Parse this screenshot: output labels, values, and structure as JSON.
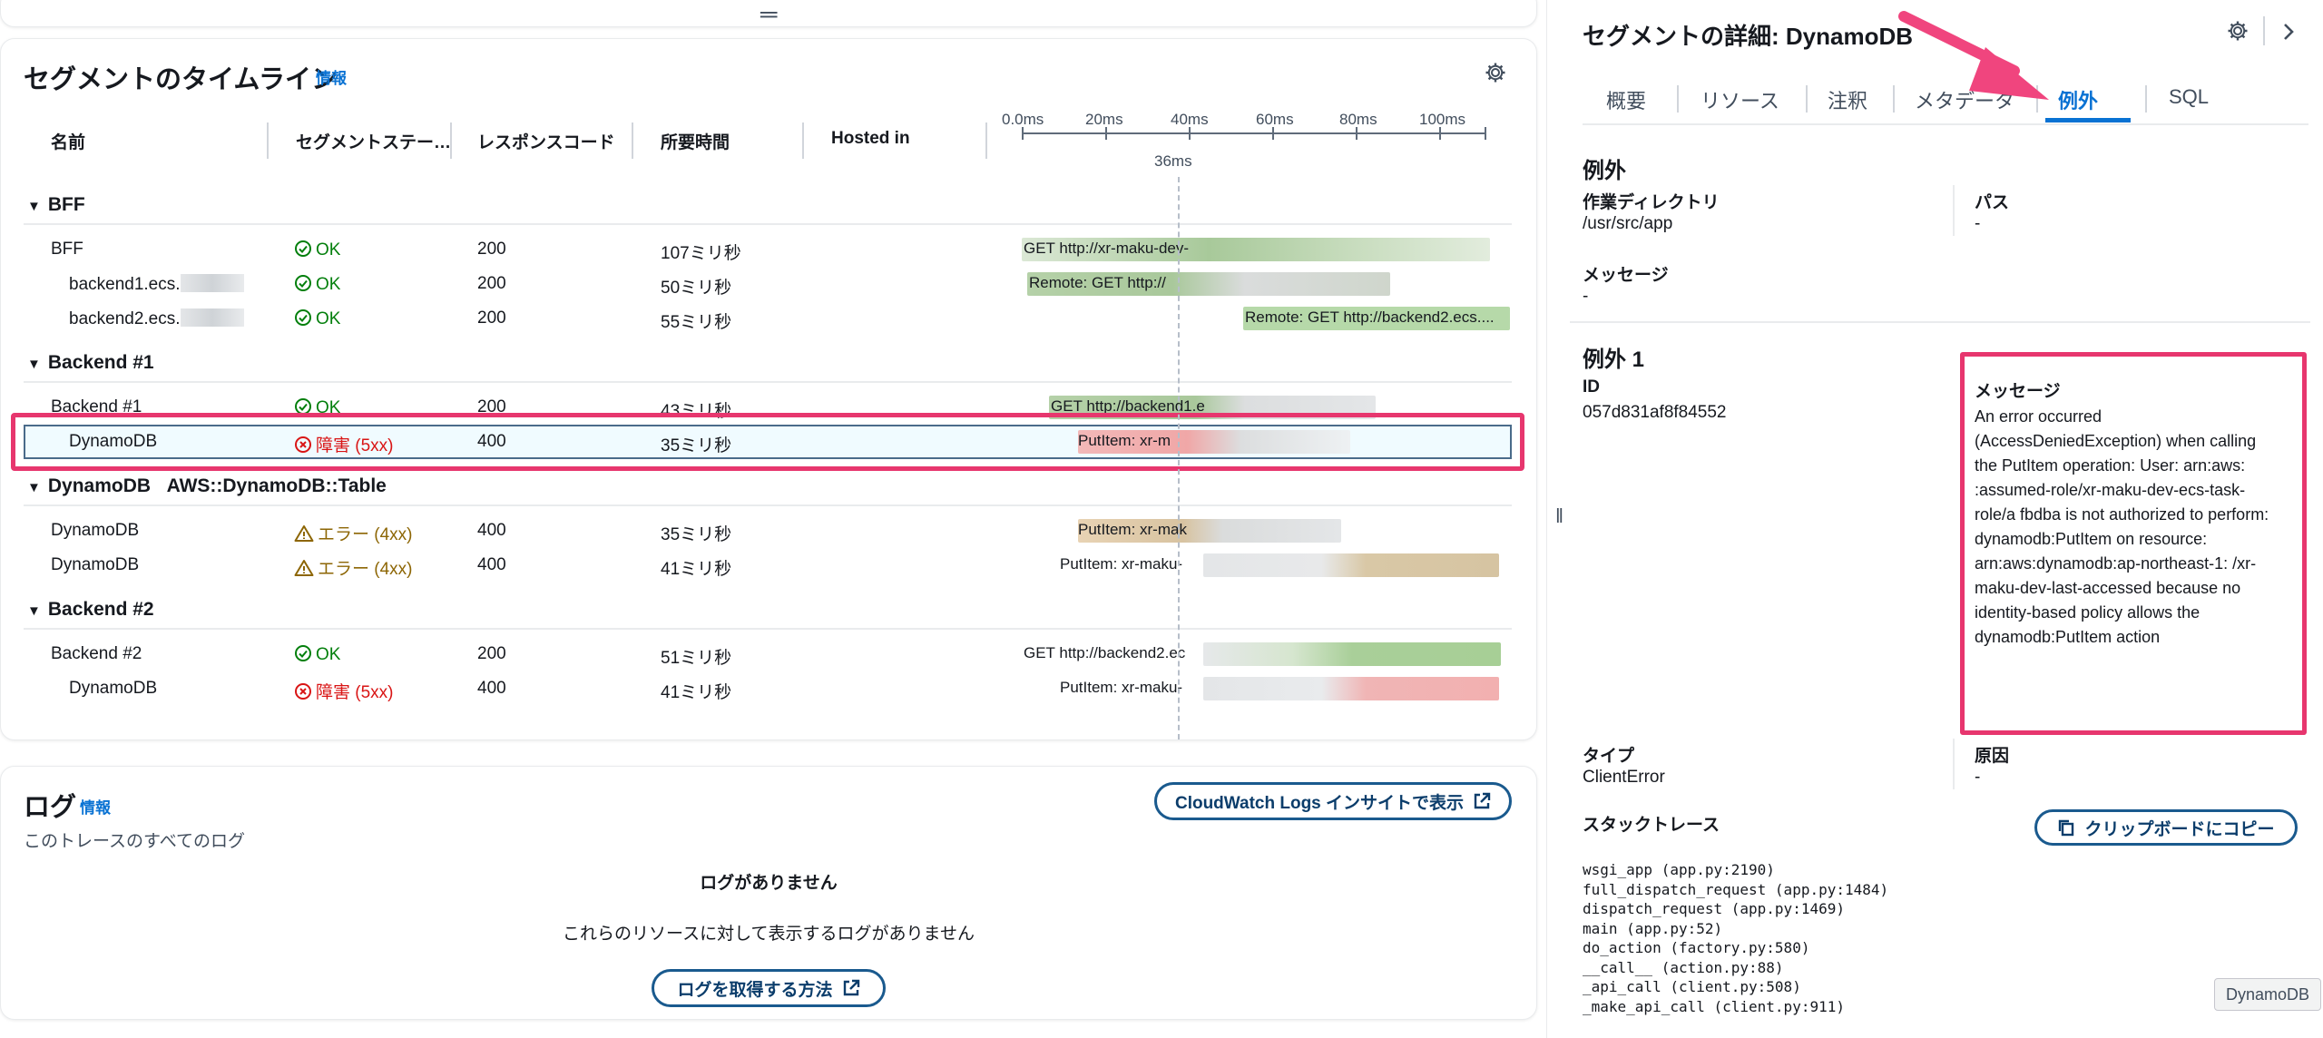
{
  "timeline": {
    "title": "セグメントのタイムライン",
    "info": "情報",
    "columns": [
      "名前",
      "セグメントステー…",
      "レスポンスコード",
      "所要時間",
      "Hosted in"
    ],
    "ticks": [
      "0.0ms",
      "20ms",
      "40ms",
      "60ms",
      "80ms",
      "100ms"
    ],
    "cursor": "36ms",
    "groups": [
      {
        "name": "BFF",
        "suffix": ""
      },
      {
        "name": "Backend #1",
        "suffix": ""
      },
      {
        "name": "DynamoDB",
        "suffix": "AWS::DynamoDB::Table"
      },
      {
        "name": "Backend #2",
        "suffix": ""
      }
    ],
    "rows": [
      {
        "name": "BFF",
        "status": "OK",
        "code": "200",
        "duration": "107ミリ秒",
        "bar": "GET http://xr-maku-dev-"
      },
      {
        "name": "backend1.ecs.",
        "status": "OK",
        "code": "200",
        "duration": "50ミリ秒",
        "bar": "Remote: GET http://"
      },
      {
        "name": "backend2.ecs.",
        "status": "OK",
        "code": "200",
        "duration": "55ミリ秒",
        "bar": "Remote: GET http://backend2.ecs...."
      },
      {
        "name": "Backend #1",
        "status": "OK",
        "code": "200",
        "duration": "43ミリ秒",
        "bar": "GET http://backend1.e"
      },
      {
        "name": "DynamoDB",
        "status": "障害 (5xx)",
        "code": "400",
        "duration": "35ミリ秒",
        "bar": "PutItem: xr-m"
      },
      {
        "name": "DynamoDB",
        "status": "エラー (4xx)",
        "code": "400",
        "duration": "35ミリ秒",
        "bar": "PutItem: xr-mak"
      },
      {
        "name": "DynamoDB",
        "status": "エラー (4xx)",
        "code": "400",
        "duration": "41ミリ秒",
        "bar": "PutItem: xr-maku-"
      },
      {
        "name": "Backend #2",
        "status": "OK",
        "code": "200",
        "duration": "51ミリ秒",
        "bar": "GET http://backend2.ec"
      },
      {
        "name": "DynamoDB",
        "status": "障害 (5xx)",
        "code": "400",
        "duration": "41ミリ秒",
        "bar": "PutItem: xr-maku-"
      }
    ]
  },
  "logs": {
    "title": "ログ",
    "info": "情報",
    "subtitle": "このトレースのすべてのログ",
    "insights_button": "CloudWatch Logs インサイトで表示",
    "empty_title": "ログがありません",
    "empty_body": "これらのリソースに対して表示するログがありません",
    "howto_button": "ログを取得する方法"
  },
  "details": {
    "title": "セグメントの詳細: DynamoDB",
    "tabs": [
      "概要",
      "リソース",
      "注釈",
      "メタデータ",
      "例外",
      "SQL"
    ],
    "active_tab": "例外",
    "section": "例外",
    "workdir_label": "作業ディレクトリ",
    "workdir_value": "/usr/src/app",
    "path_label": "パス",
    "path_value": "-",
    "message_label": "メッセージ",
    "message_value": "-",
    "exception_title": "例外 1",
    "id_label": "ID",
    "id_value": "057d831af8f84552",
    "exc_message_label": "メッセージ",
    "exc_message": "An error occurred (AccessDeniedException) when calling the PutItem operation: User: arn:aws:            :assumed-role/xr-maku-dev-ecs-task-role/a                          fbdba is not authorized to perform: dynamodb:PutItem on resource: arn:aws:dynamodb:ap-northeast-1:              /xr-maku-dev-last-accessed because no identity-based policy allows the dynamodb:PutItem action",
    "type_label": "タイプ",
    "type_value": "ClientError",
    "cause_label": "原因",
    "cause_value": "-",
    "stack_label": "スタックトレース",
    "copy_button": "クリップボードにコピー",
    "stack": "wsgi_app (app.py:2190)\nfull_dispatch_request (app.py:1484)\ndispatch_request (app.py:1469)\nmain (app.py:52)\ndo_action (factory.py:580)\n__call__ (action.py:88)\n_api_call (client.py:508)\n_make_api_call (client.py:911)"
  },
  "tooltip": "DynamoDB",
  "colors": {
    "ok": "#037f0c",
    "fault": "#d91515",
    "error": "#8d6605",
    "highlight": "#e7366e",
    "link": "#0972d3"
  }
}
